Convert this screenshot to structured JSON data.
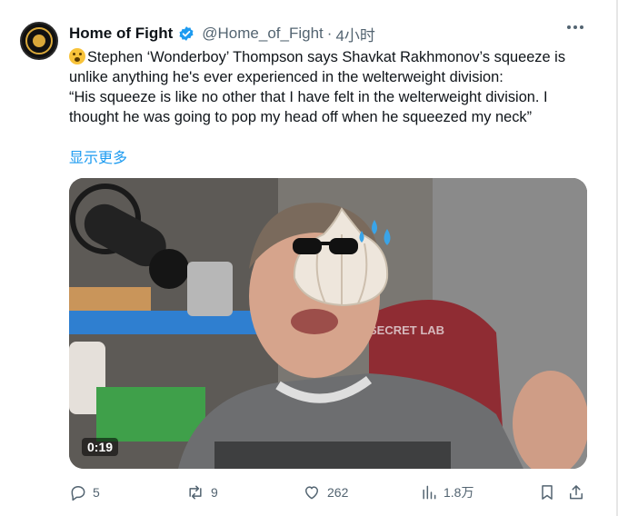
{
  "tweet": {
    "author_name": "Home of Fight",
    "handle": "@Home_of_Fight",
    "separator": "·",
    "time": "4小时",
    "text_line1": "Stephen ‘Wonderboy’ Thompson says Shavkat Rakhmonov’s squeeze is",
    "text_line2": "unlike anything he's ever experienced in the welterweight division:",
    "quote_line1": "“His squeeze is like no other that I have felt in the welterweight division. I",
    "quote_line2": "thought he was going to pop my head off when he squeezed my neck”",
    "show_more": "显示更多",
    "video_duration": "0:19",
    "video_chair_text": "SECRET LAB"
  },
  "actions": {
    "replies": "5",
    "retweets": "9",
    "likes": "262",
    "views": "1.8万"
  },
  "icons": {
    "verified": "verified-badge-icon",
    "more": "more-horizontal-icon",
    "reply": "reply-icon",
    "retweet": "retweet-icon",
    "like": "heart-icon",
    "views": "views-icon",
    "bookmark": "bookmark-icon",
    "share": "share-icon"
  },
  "colors": {
    "accent": "#1d9bf0",
    "text": "#0f1419",
    "muted": "#536471"
  }
}
